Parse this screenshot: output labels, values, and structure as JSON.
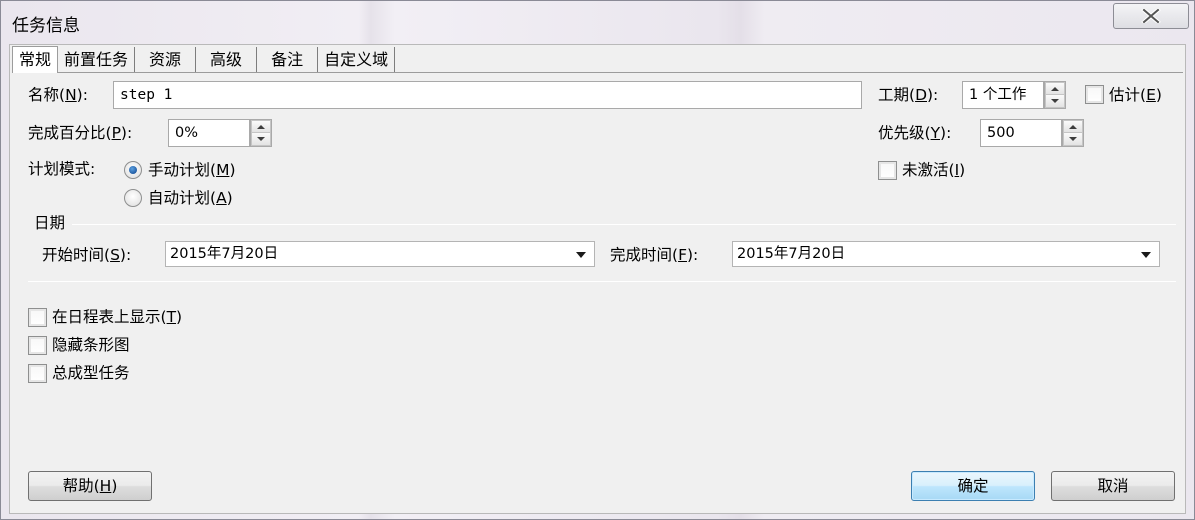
{
  "window": {
    "title": "任务信息"
  },
  "tabs": [
    {
      "label": "常规",
      "active": true
    },
    {
      "label": "前置任务",
      "active": false
    },
    {
      "label": "资源",
      "active": false
    },
    {
      "label": "高级",
      "active": false
    },
    {
      "label": "备注",
      "active": false
    },
    {
      "label": "自定义域",
      "active": false
    }
  ],
  "general": {
    "name_label": "名称(",
    "name_key": "N",
    "name_suffix": "):",
    "name_value": "step 1",
    "duration_label": "工期(",
    "duration_key": "D",
    "duration_suffix": "):",
    "duration_value": "1 个工作",
    "estimated_label": "估计(",
    "estimated_key": "E",
    "estimated_suffix": ")",
    "estimated_checked": false,
    "percent_label": "完成百分比(",
    "percent_key": "P",
    "percent_suffix": "):",
    "percent_value": "0%",
    "priority_label": "优先级(",
    "priority_key": "Y",
    "priority_suffix": "):",
    "priority_value": "500",
    "schedule_mode_label": "计划模式:",
    "manual_label": "手动计划(",
    "manual_key": "M",
    "manual_suffix": ")",
    "manual_selected": true,
    "auto_label": "自动计划(",
    "auto_key": "A",
    "auto_suffix": ")",
    "auto_selected": false,
    "inactive_label": "未激活(",
    "inactive_key": "I",
    "inactive_suffix": ")",
    "inactive_checked": false
  },
  "dates": {
    "group_label": "日期",
    "start_label": "开始时间(",
    "start_key": "S",
    "start_suffix": "):",
    "start_value": "2015年7月20日",
    "finish_label": "完成时间(",
    "finish_key": "F",
    "finish_suffix": "):",
    "finish_value": "2015年7月20日"
  },
  "options": {
    "timeline_label": "在日程表上显示(",
    "timeline_key": "T",
    "timeline_suffix": ")",
    "timeline_checked": false,
    "hide_bar_label": "隐藏条形图",
    "hide_bar_checked": false,
    "summary_label": "总成型任务",
    "summary_checked": false
  },
  "buttons": {
    "help_label": "帮助(",
    "help_key": "H",
    "help_suffix": ")",
    "ok_label": "确定",
    "cancel_label": "取消"
  },
  "icons": {
    "close": "close-icon",
    "spin_up": "spin-up-icon",
    "spin_down": "spin-down-icon",
    "dropdown": "chevron-down-icon"
  }
}
